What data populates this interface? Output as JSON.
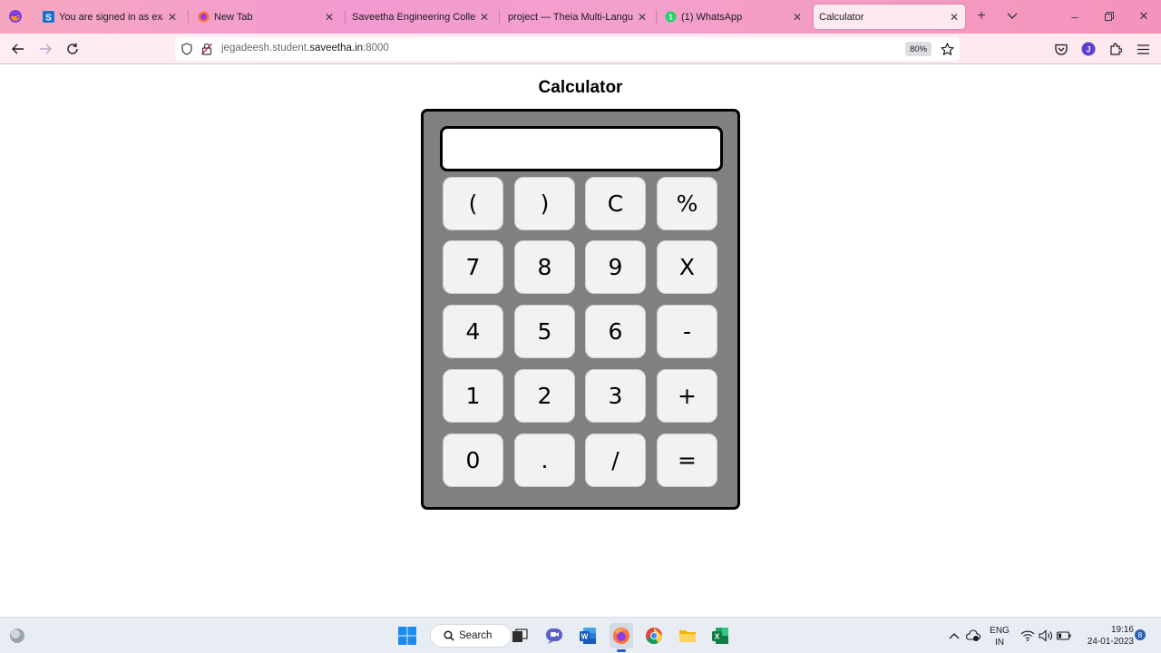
{
  "browser": {
    "tabs": [
      {
        "title": "You are signed in as examu",
        "icon": "saveetha-s-icon",
        "active": false
      },
      {
        "title": "New Tab",
        "icon": "firefox-icon",
        "active": false
      },
      {
        "title": "Saveetha Engineering College",
        "icon": "",
        "active": false
      },
      {
        "title": "project — Theia Multi-Language",
        "icon": "",
        "active": false
      },
      {
        "title": "(1) WhatsApp",
        "icon": "whatsapp-icon",
        "active": false
      },
      {
        "title": "Calculator",
        "icon": "",
        "active": true
      }
    ],
    "url": {
      "prefix": "jegadeesh.student.",
      "host": "saveetha.in",
      "suffix": ":8000"
    },
    "zoom": "80%",
    "profile_initial": "J"
  },
  "page": {
    "title": "Calculator"
  },
  "calculator": {
    "display_value": "",
    "keys": [
      [
        "(",
        ")",
        "C",
        "%"
      ],
      [
        "7",
        "8",
        "9",
        "X"
      ],
      [
        "4",
        "5",
        "6",
        "-"
      ],
      [
        "1",
        "2",
        "3",
        "+"
      ],
      [
        "0",
        ".",
        "/",
        "="
      ]
    ]
  },
  "taskbar": {
    "search_label": "Search",
    "language": "ENG",
    "region": "IN",
    "time": "19:16",
    "date": "24-01-2023",
    "notification_count": "8"
  },
  "colors": {
    "calc_body": "#808080",
    "key_face": "#f2f2f2",
    "tabstrip_accent": "#f39ad0"
  }
}
